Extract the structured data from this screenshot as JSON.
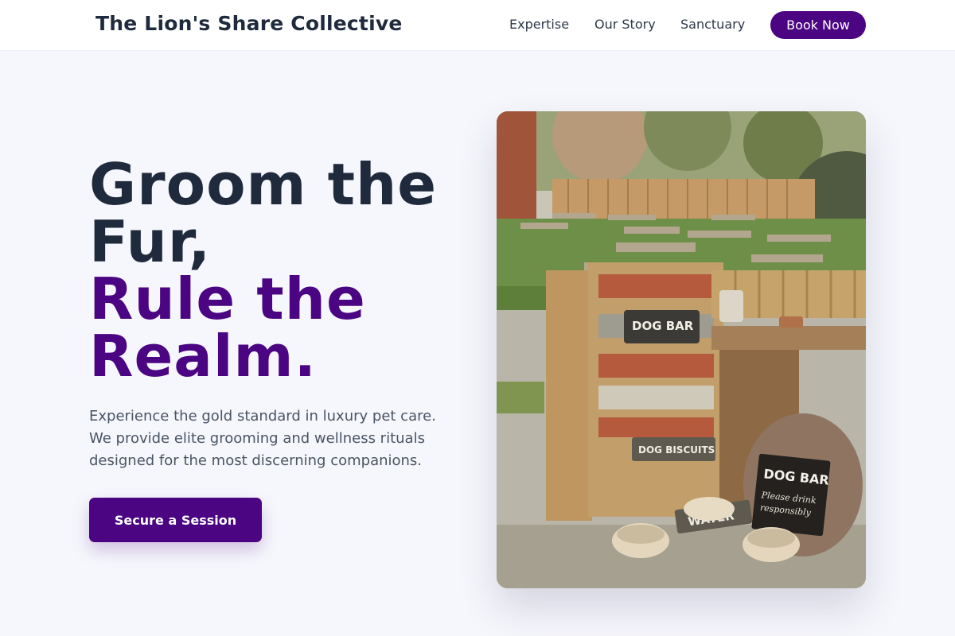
{
  "header": {
    "brand": "The Lion's Share Collective",
    "nav": [
      {
        "label": "Expertise"
      },
      {
        "label": "Our Story"
      },
      {
        "label": "Sanctuary"
      }
    ],
    "cta_label": "Book Now"
  },
  "hero": {
    "headline_line1": "Groom the",
    "headline_line2": "Fur,",
    "headline_line3": "Rule the",
    "headline_line4": "Realm.",
    "description": "Experience the gold standard in luxury pet care. We provide elite grooming and wellness rituals designed for the most discerning companions.",
    "cta_label": "Secure a Session"
  },
  "photo": {
    "sign_dog_bar_top": "DOG BAR",
    "sign_biscuits": "DOG BISCUITS",
    "sign_water": "WATER",
    "sign_chalk_title": "DOG BAR",
    "sign_chalk_line1": "Please drink",
    "sign_chalk_line2": "responsibly"
  },
  "colors": {
    "brand_purple": "#4b0582",
    "heading_dark": "#1f2a3c",
    "page_background": "#f6f7fc"
  }
}
